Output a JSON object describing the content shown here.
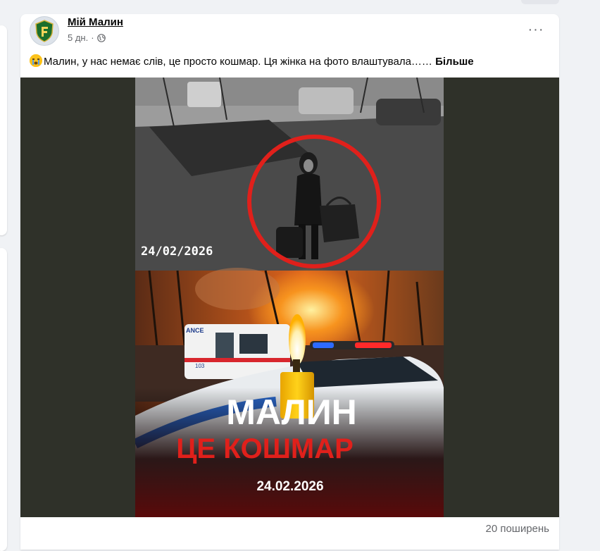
{
  "post": {
    "page_name": "Мій Малин",
    "time": "5 дн.",
    "separator": "·",
    "text": "Малин, у нас немає слів, це просто кошмар. Ця жінка на фото влаштувала……",
    "see_more": "Більше",
    "more_icon": "···"
  },
  "media": {
    "cctv_timestamp": "24/02/2026",
    "headline_line1": "МАЛИН",
    "headline_line2": "ЦЕ КОШМАР",
    "headline_date": "24.02.2026",
    "ambulance_text": "АNCE",
    "ambulance_number": "103"
  },
  "footer": {
    "shares": "20 поширень"
  },
  "colors": {
    "accent_red": "#e0201b",
    "text_secondary": "#65676b",
    "page_bg": "#f0f2f5"
  }
}
